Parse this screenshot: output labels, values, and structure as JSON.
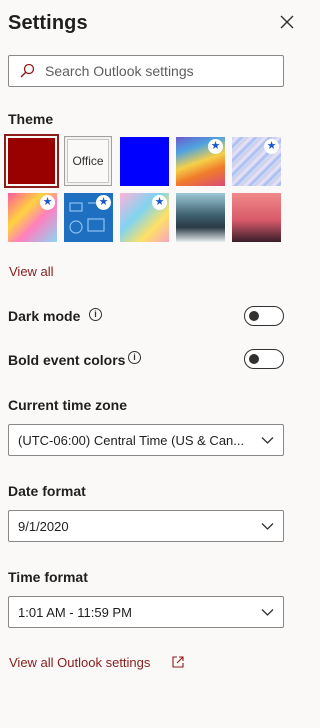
{
  "header": {
    "title": "Settings"
  },
  "search": {
    "placeholder": "Search Outlook settings"
  },
  "theme": {
    "label": "Theme",
    "office_label": "Office",
    "view_all": "View all",
    "colors": {
      "selected": "#990000",
      "blue": "#0000ff"
    }
  },
  "dark_mode": {
    "label": "Dark mode",
    "enabled": false
  },
  "bold_event_colors": {
    "label": "Bold event colors",
    "enabled": false
  },
  "time_zone": {
    "label": "Current time zone",
    "value": "(UTC-06:00) Central Time (US & Can..."
  },
  "date_format": {
    "label": "Date format",
    "value": "9/1/2020"
  },
  "time_format": {
    "label": "Time format",
    "value": "1:01 AM - 11:59 PM"
  },
  "footer": {
    "view_all_settings": "View all Outlook settings"
  },
  "icons": [
    "close-icon",
    "search-icon",
    "info-icon",
    "chevron-down-icon",
    "open-external-icon",
    "star-icon"
  ],
  "accent": "#8a1c1c"
}
